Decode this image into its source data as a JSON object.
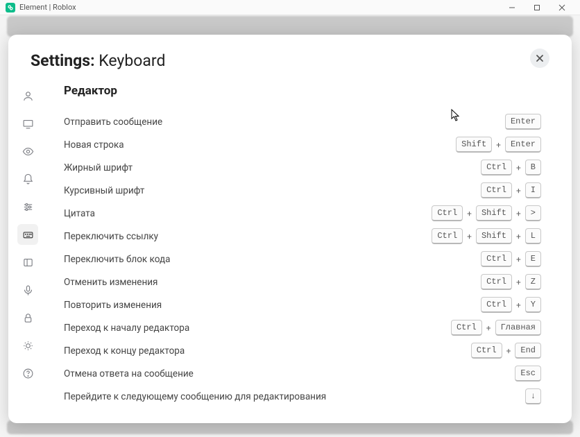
{
  "window": {
    "title": "Element | Roblox"
  },
  "modal": {
    "title_bold": "Settings:",
    "title_light": "Keyboard",
    "section_title": "Редактор"
  },
  "shortcuts": [
    {
      "label": "Отправить сообщение",
      "keys": [
        "Enter"
      ]
    },
    {
      "label": "Новая строка",
      "keys": [
        "Shift",
        "Enter"
      ]
    },
    {
      "label": "Жирный шрифт",
      "keys": [
        "Ctrl",
        "B"
      ]
    },
    {
      "label": "Курсивный шрифт",
      "keys": [
        "Ctrl",
        "I"
      ]
    },
    {
      "label": "Цитата",
      "keys": [
        "Ctrl",
        "Shift",
        ">"
      ]
    },
    {
      "label": "Переключить ссылку",
      "keys": [
        "Ctrl",
        "Shift",
        "L"
      ]
    },
    {
      "label": "Переключить блок кода",
      "keys": [
        "Ctrl",
        "E"
      ]
    },
    {
      "label": "Отменить изменения",
      "keys": [
        "Ctrl",
        "Z"
      ]
    },
    {
      "label": "Повторить изменения",
      "keys": [
        "Ctrl",
        "Y"
      ]
    },
    {
      "label": "Переход к началу редактора",
      "keys": [
        "Ctrl",
        "Главная"
      ]
    },
    {
      "label": "Переход к концу редактора",
      "keys": [
        "Ctrl",
        "End"
      ]
    },
    {
      "label": "Отмена ответа на сообщение",
      "keys": [
        "Esc"
      ]
    },
    {
      "label": "Перейдите к следующему сообщению для редактирования",
      "keys": [
        "↓"
      ]
    }
  ],
  "sidebar": {
    "items": [
      {
        "name": "general",
        "active": false
      },
      {
        "name": "appearance",
        "active": false
      },
      {
        "name": "notifications-eye",
        "active": false
      },
      {
        "name": "notifications-bell",
        "active": false
      },
      {
        "name": "preferences",
        "active": false
      },
      {
        "name": "keyboard",
        "active": true
      },
      {
        "name": "sidebar-panel",
        "active": false
      },
      {
        "name": "voice",
        "active": false
      },
      {
        "name": "security",
        "active": false
      },
      {
        "name": "labs",
        "active": false
      },
      {
        "name": "help",
        "active": false
      }
    ]
  }
}
